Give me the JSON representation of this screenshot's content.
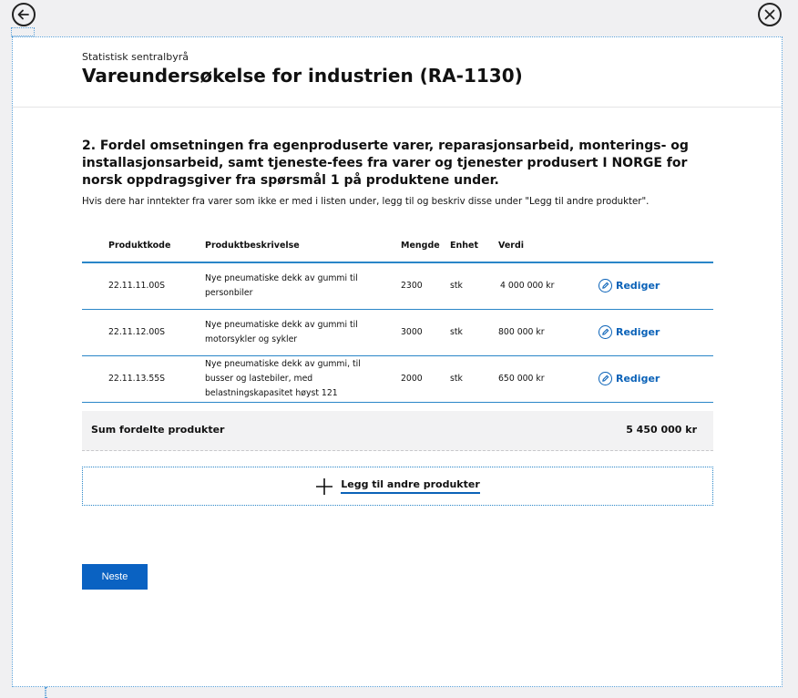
{
  "nav": {
    "back_icon": "arrow-left-circle-icon",
    "close_icon": "close-circle-icon"
  },
  "header": {
    "organization": "Statistisk sentralbyrå",
    "title": "Vareundersøkelse for industrien (RA-1130)"
  },
  "question": {
    "text": "2. Fordel omsetningen fra egenproduserte varer, reparasjonsarbeid, monterings- og installasjonsarbeid, samt tjeneste-fees fra varer og tjenester produsert I NORGE for norsk oppdragsgiver fra spørsmål 1 på produktene under.",
    "hint": "Hvis dere har inntekter fra varer som ikke er med i listen under, legg til og beskriv disse under \"Legg til andre produkter\"."
  },
  "table": {
    "columns": {
      "code": "Produktkode",
      "description": "Produktbeskrivelse",
      "quantity": "Mengde",
      "unit": "Enhet",
      "value": "Verdi"
    },
    "rows": [
      {
        "code": "22.11.11.00S",
        "description": "Nye pneumatiske dekk av gummi til personbiler",
        "quantity": "2300",
        "unit": "stk",
        "value": "4 000 000 kr",
        "edit_label": "Rediger"
      },
      {
        "code": "22.11.12.00S",
        "description": "Nye pneumatiske dekk av gummi til motorsykler og sykler",
        "quantity": "3000",
        "unit": "stk",
        "value": "800 000 kr",
        "edit_label": "Rediger"
      },
      {
        "code": "22.11.13.55S",
        "description": "Nye pneumatiske dekk av gummi, til busser og lastebiler, med belastningskapasitet høyst 121",
        "quantity": "2000",
        "unit": "stk",
        "value": "650 000 kr",
        "edit_label": "Rediger"
      }
    ]
  },
  "sum": {
    "label": "Sum fordelte produkter",
    "value": "5 450 000 kr"
  },
  "add_products": {
    "label": "Legg til andre produkter",
    "icon": "plus-icon"
  },
  "next_button": {
    "label": "Neste"
  },
  "colors": {
    "accent": "#0a62c2",
    "divider": "#2a86c8",
    "background": "#f0f0f2"
  }
}
